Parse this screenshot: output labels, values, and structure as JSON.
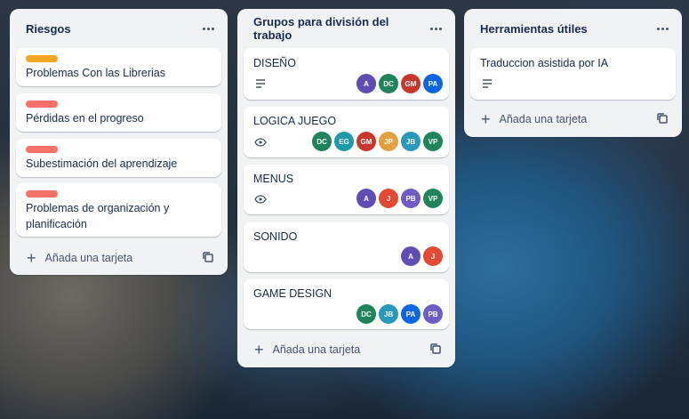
{
  "colors": {
    "list_bg": "#f1f2f4",
    "card_bg": "#ffffff",
    "label_orange": "#f5a623",
    "label_red": "#f87168"
  },
  "lists": [
    {
      "title": "Riesgos",
      "add_label": "Añada una tarjeta",
      "cards": [
        {
          "label_color": "#f5a623",
          "title": "Problemas Con las Librerias"
        },
        {
          "label_color": "#f87168",
          "title": "Pérdidas en el progreso"
        },
        {
          "label_color": "#f87168",
          "title": "Subestimación del aprendizaje"
        },
        {
          "label_color": "#f87168",
          "title_line1": "Problemas de organización y",
          "title_line2": "planificación"
        }
      ]
    },
    {
      "title": "Grupos para división del trabajo",
      "add_label": "Añada una tarjeta",
      "cards": [
        {
          "title": "DISEÑO",
          "badge": "description-icon",
          "members": [
            "A",
            "DC",
            "GM",
            "PA"
          ]
        },
        {
          "title": "LOGICA JUEGO",
          "badge": "eye-icon",
          "members": [
            "DC",
            "EG",
            "GM",
            "JP",
            "JB",
            "VP"
          ]
        },
        {
          "title": "MENUS",
          "badge": "eye-icon",
          "members": [
            "A",
            "J",
            "PB",
            "VP"
          ]
        },
        {
          "title": "SONIDO",
          "members": [
            "A",
            "J"
          ]
        },
        {
          "title": "GAME DESIGN",
          "members": [
            "DC",
            "JB",
            "PA",
            "PB"
          ]
        }
      ]
    },
    {
      "title": "Herramientas útiles",
      "add_label": "Añada una tarjeta",
      "cards": [
        {
          "title": "Traduccion asistida por IA",
          "badge": "description-icon"
        }
      ]
    }
  ],
  "member_colors": {
    "A": "#5e4db2",
    "DC": "#1f845a",
    "GM": "#c9372c",
    "PA": "#0c66e4",
    "EG": "#1d9aaa",
    "JP": "#e2a03f",
    "JB": "#2898bd",
    "VP": "#1f845a",
    "J": "#e34935",
    "PB": "#6e5dc6"
  }
}
